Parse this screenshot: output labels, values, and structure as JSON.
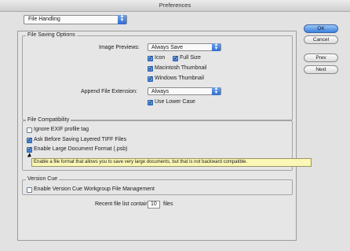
{
  "window": {
    "title": "Preferences"
  },
  "section_selector": {
    "value": "File Handling"
  },
  "buttons": {
    "ok": "OK",
    "cancel": "Cancel",
    "prev": "Prev",
    "next": "Next"
  },
  "file_saving": {
    "group_label": "File Saving Options",
    "image_previews_label": "Image Previews:",
    "image_previews_value": "Always Save",
    "icon": {
      "label": "Icon",
      "checked": true
    },
    "full_size": {
      "label": "Full Size",
      "checked": true
    },
    "mac_thumb": {
      "label": "Macintosh Thumbnail",
      "checked": true
    },
    "win_thumb": {
      "label": "Windows Thumbnail",
      "checked": true
    },
    "append_label": "Append File Extension:",
    "append_value": "Always",
    "lower_case": {
      "label": "Use Lower Case",
      "checked": true
    }
  },
  "compat": {
    "group_label": "File Compatibility",
    "ignore_exif": {
      "label": "Ignore EXIF profile tag",
      "checked": false
    },
    "ask_tiff": {
      "label": "Ask Before Saving Layered TIFF Files",
      "checked": true
    },
    "large_doc": {
      "label": "Enable Large Document Format (.psb)",
      "checked": true
    }
  },
  "tooltip": "Enable a file format that allows you to save very large documents, but that is not backward compatible.",
  "version_cue": {
    "group_label": "Version Cue",
    "enable": {
      "label": "Enable Version Cue Workgroup File Management",
      "checked": false
    }
  },
  "recent": {
    "label": "Recent file list contains:",
    "value": "10",
    "unit": "files"
  },
  "icons": {
    "popup_arrows": "up-down-arrows-icon",
    "check": "checkmark-icon"
  }
}
